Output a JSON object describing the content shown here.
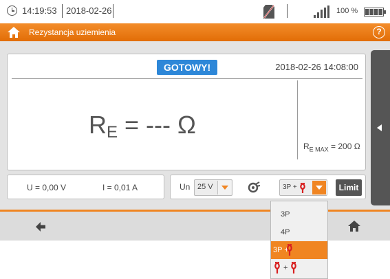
{
  "statusbar": {
    "time": "14:19:53",
    "date": "2018-02-26",
    "battery_percent": "100 %",
    "icons": [
      "clock-icon",
      "sd-card-icon",
      "signal-icon",
      "battery-icon"
    ]
  },
  "titlebar": {
    "title": "Rezystancja uziemienia",
    "help_label": "?",
    "color": "#f08522"
  },
  "panel": {
    "status": "GOTOWY!",
    "status_color": "#2d87d8",
    "datetime": "2018-02-26 14:08:00",
    "reading_symbol": "R",
    "reading_sub": "E",
    "reading_value": " = --- Ω",
    "rmax_symbol": "R",
    "rmax_sub": "E MAX",
    "rmax_value": " = 200 Ω"
  },
  "measurements": {
    "u": "U = 0,00 V",
    "i": "I = 0,01 A"
  },
  "controls": {
    "un_label": "Un",
    "un_value": "25 V",
    "mode_value": "3P +",
    "limit_label": "Limit"
  },
  "dropdown": {
    "options": [
      "3P",
      "4P",
      "3P +",
      "+"
    ],
    "selected_index": 2
  },
  "bottombar": {
    "icons": [
      "back-arrow-icon",
      "home-icon"
    ]
  }
}
